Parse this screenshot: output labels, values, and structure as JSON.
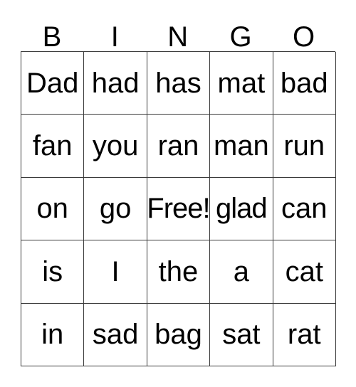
{
  "card": {
    "title": "BINGO",
    "columns": [
      "B",
      "I",
      "N",
      "G",
      "O"
    ],
    "grid_colors": {
      "border": "#3a3a3a",
      "background": "#ffffff",
      "text": "#000000"
    },
    "rows": [
      {
        "cells": [
          {
            "text": "Dad",
            "marked": false,
            "free": false
          },
          {
            "text": "had",
            "marked": false,
            "free": false
          },
          {
            "text": "has",
            "marked": false,
            "free": false
          },
          {
            "text": "mat",
            "marked": false,
            "free": false
          },
          {
            "text": "bad",
            "marked": false,
            "free": false
          }
        ]
      },
      {
        "cells": [
          {
            "text": "fan",
            "marked": false,
            "free": false
          },
          {
            "text": "you",
            "marked": false,
            "free": false
          },
          {
            "text": "ran",
            "marked": false,
            "free": false
          },
          {
            "text": "man",
            "marked": false,
            "free": false
          },
          {
            "text": "run",
            "marked": false,
            "free": false
          }
        ]
      },
      {
        "cells": [
          {
            "text": "on",
            "marked": false,
            "free": false
          },
          {
            "text": "go",
            "marked": false,
            "free": false
          },
          {
            "text": "Free!",
            "marked": false,
            "free": true
          },
          {
            "text": "glad",
            "marked": false,
            "free": false
          },
          {
            "text": "can",
            "marked": false,
            "free": false
          }
        ]
      },
      {
        "cells": [
          {
            "text": "is",
            "marked": false,
            "free": false
          },
          {
            "text": "I",
            "marked": false,
            "free": false
          },
          {
            "text": "the",
            "marked": false,
            "free": false
          },
          {
            "text": "a",
            "marked": false,
            "free": false
          },
          {
            "text": "cat",
            "marked": false,
            "free": false
          }
        ]
      },
      {
        "cells": [
          {
            "text": "in",
            "marked": false,
            "free": false
          },
          {
            "text": "sad",
            "marked": false,
            "free": false
          },
          {
            "text": "bag",
            "marked": false,
            "free": false
          },
          {
            "text": "sat",
            "marked": false,
            "free": false
          },
          {
            "text": "rat",
            "marked": false,
            "free": false
          }
        ]
      }
    ]
  }
}
